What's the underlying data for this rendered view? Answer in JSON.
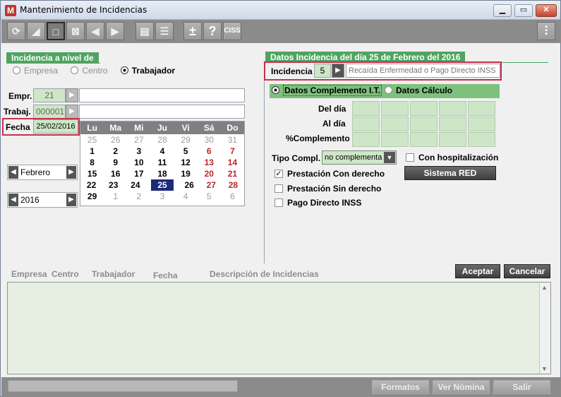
{
  "window": {
    "title": "Mantenimiento de Incidencias"
  },
  "toolbar": {
    "ciss_label": "CISS",
    "plusminus": "±",
    "help": "?"
  },
  "nivel": {
    "title": "Incidencia a nivel de",
    "options": [
      "Empresa",
      "Centro",
      "Trabajador"
    ],
    "selected": "Trabajador"
  },
  "form": {
    "empr_label": "Empr.",
    "empr_value": "21",
    "trabaj_label": "Trabaj.",
    "trabaj_value": "000001",
    "fecha_label": "Fecha",
    "fecha_value": "25/02/2016"
  },
  "calendar": {
    "weekdays": [
      "Lu",
      "Ma",
      "Mi",
      "Ju",
      "Vi",
      "Sá",
      "Do"
    ],
    "weeks": [
      [
        "25",
        "26",
        "27",
        "28",
        "29",
        "30",
        "31"
      ],
      [
        "1",
        "2",
        "3",
        "4",
        "5",
        "6",
        "7"
      ],
      [
        "8",
        "9",
        "10",
        "11",
        "12",
        "13",
        "14"
      ],
      [
        "15",
        "16",
        "17",
        "18",
        "19",
        "20",
        "21"
      ],
      [
        "22",
        "23",
        "24",
        "25",
        "26",
        "27",
        "28"
      ],
      [
        "29",
        "1",
        "2",
        "3",
        "4",
        "5",
        "6"
      ]
    ],
    "month": "Febrero",
    "year": "2016",
    "selected_day": "25"
  },
  "datos": {
    "title": "Datos Incidencia del día 25 de Febrero del 2016",
    "incidencia_label": "Incidencia",
    "incidencia_code": "5",
    "incidencia_desc": "Recaída Enfermedad o Pago Directo INSS"
  },
  "tabs": {
    "complemento": "Datos Complemento I.T.",
    "calculo": "Datos Cálculo"
  },
  "grid": {
    "rows": [
      "Del día",
      "Al día",
      "%Complemento"
    ]
  },
  "tipo": {
    "label": "Tipo Compl.",
    "value": "no complementa",
    "hospital_label": "Con hospitalización"
  },
  "checks": {
    "con_derecho": "Prestación Con derecho",
    "sin_derecho": "Prestación Sin derecho",
    "pago_directo": "Pago Directo INSS"
  },
  "buttons": {
    "sistema_red": "Sistema RED",
    "aceptar": "Aceptar",
    "cancelar": "Cancelar",
    "formatos": "Formatos",
    "ver_nomina": "Ver Nómina",
    "salir": "Salir"
  },
  "list": {
    "headers": [
      "Empresa",
      "Centro",
      "Trabajador",
      "Fecha",
      "Descripción de Incidencias"
    ]
  }
}
